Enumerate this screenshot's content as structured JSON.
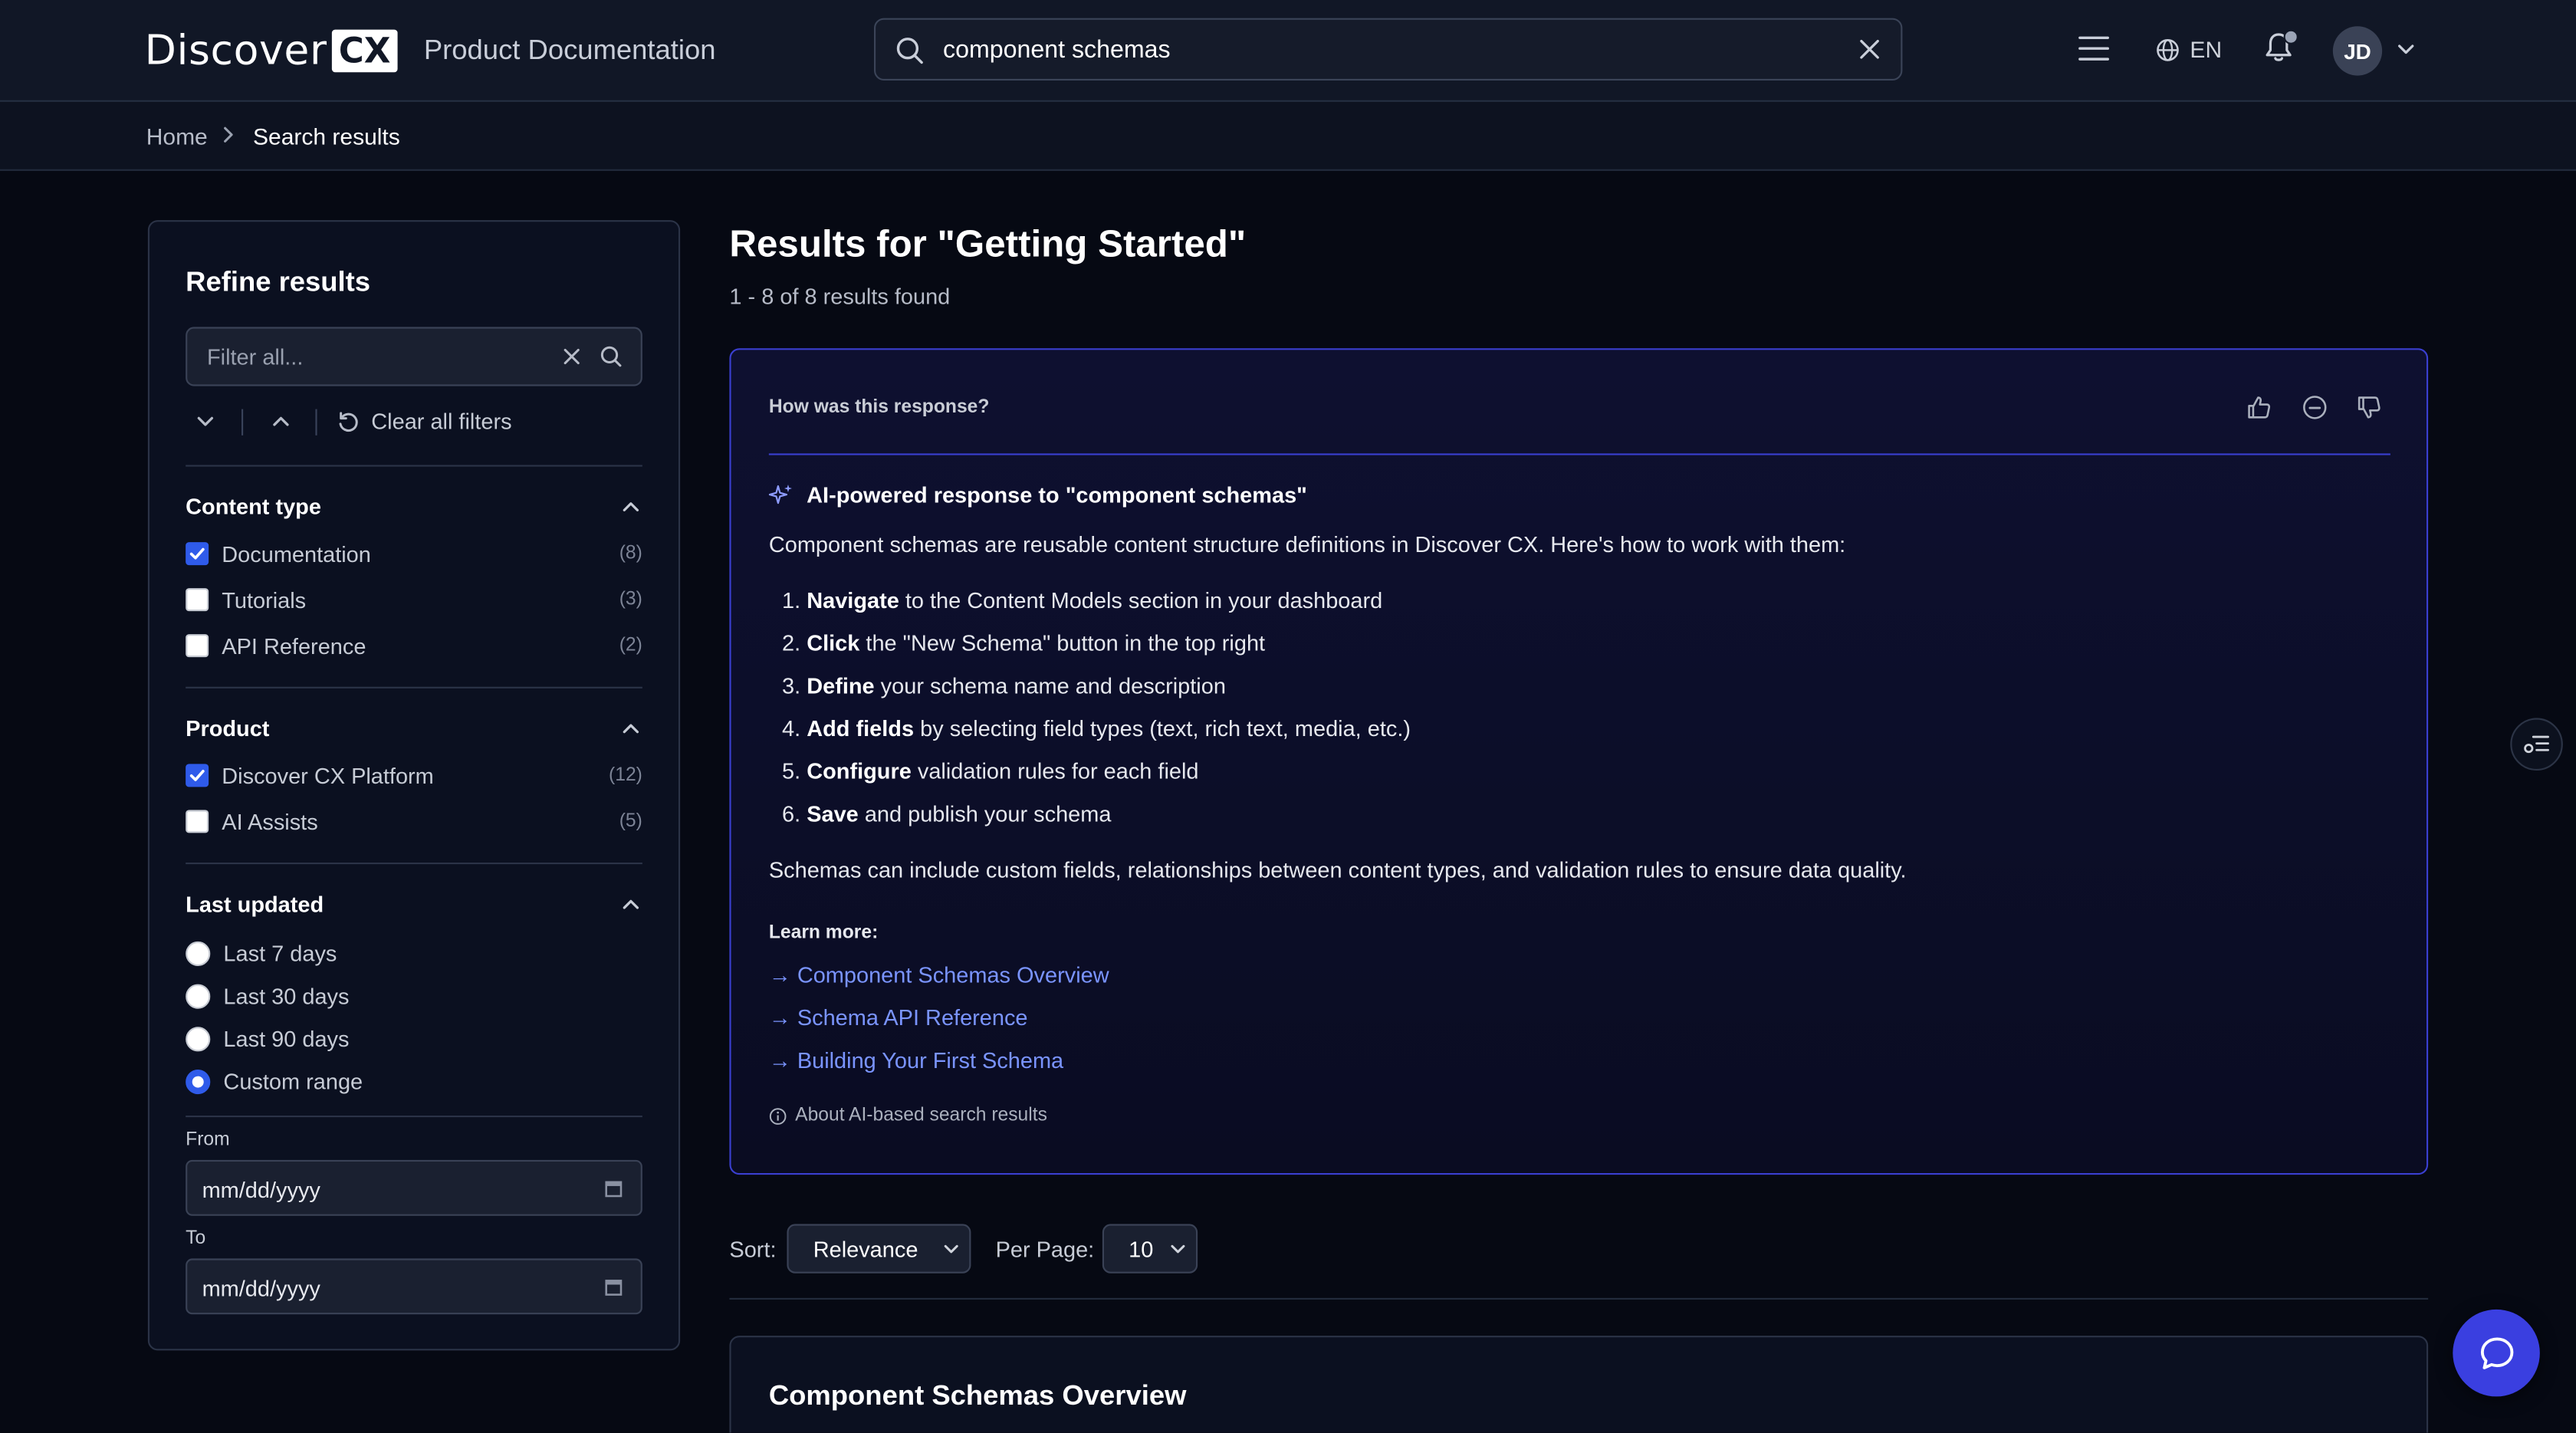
{
  "header": {
    "logo_word": "Discover",
    "logo_badge": "CX",
    "product_title": "Product Documentation",
    "search_value": "component schemas",
    "language": "EN",
    "avatar_initials": "JD"
  },
  "breadcrumb": {
    "home": "Home",
    "current": "Search results"
  },
  "sidebar": {
    "title": "Refine results",
    "filter_placeholder": "Filter all...",
    "clear_all": "Clear all filters",
    "content_type": {
      "heading": "Content type",
      "options": [
        {
          "label": "Documentation",
          "count": "(8)",
          "checked": true
        },
        {
          "label": "Tutorials",
          "count": "(3)",
          "checked": false
        },
        {
          "label": "API Reference",
          "count": "(2)",
          "checked": false
        }
      ]
    },
    "product": {
      "heading": "Product",
      "options": [
        {
          "label": "Discover CX Platform",
          "count": "(12)",
          "checked": true
        },
        {
          "label": "AI Assists",
          "count": "(5)",
          "checked": false
        }
      ]
    },
    "last_updated": {
      "heading": "Last updated",
      "options": [
        {
          "label": "Last 7 days",
          "selected": false
        },
        {
          "label": "Last 30 days",
          "selected": false
        },
        {
          "label": "Last 90 days",
          "selected": false
        },
        {
          "label": "Custom range",
          "selected": true
        }
      ]
    },
    "from_label": "From",
    "from_placeholder": "mm/dd/yyyy",
    "to_label": "To",
    "to_placeholder": "mm/dd/yyyy"
  },
  "main": {
    "results_title": "Results for \"Getting Started\"",
    "results_count": "1 - 8 of 8 results found",
    "ai": {
      "feedback_question": "How was this response?",
      "title": "AI-powered response to \"component schemas\"",
      "intro": "Component schemas are reusable content structure definitions in Discover CX. Here's how to work with them:",
      "steps": [
        {
          "num": "1.",
          "bold": "Navigate",
          "rest": " to the Content Models section in your dashboard"
        },
        {
          "num": "2.",
          "bold": "Click",
          "rest": " the \"New Schema\" button in the top right"
        },
        {
          "num": "3.",
          "bold": "Define",
          "rest": " your schema name and description"
        },
        {
          "num": "4.",
          "bold": "Add fields",
          "rest": " by selecting field types (text, rich text, media, etc.)"
        },
        {
          "num": "5.",
          "bold": "Configure",
          "rest": " validation rules for each field"
        },
        {
          "num": "6.",
          "bold": "Save",
          "rest": " and publish your schema"
        }
      ],
      "outro": "Schemas can include custom fields, relationships between content types, and validation rules to ensure data quality.",
      "learn_more_label": "Learn more:",
      "links": [
        "→ Component Schemas Overview",
        "→ Schema API Reference",
        "→ Building Your First Schema"
      ],
      "about": "About AI-based search results"
    },
    "sort_label": "Sort:",
    "sort_value": "Relevance",
    "per_page_label": "Per Page:",
    "per_page_value": "10",
    "first_result_title": "Component Schemas Overview"
  },
  "colors": {
    "accent": "#2f5bea",
    "ai_border": "#3a3fd0",
    "link": "#7a94ff",
    "chat_button": "#3a3fe0",
    "page_bg": "#060913"
  }
}
